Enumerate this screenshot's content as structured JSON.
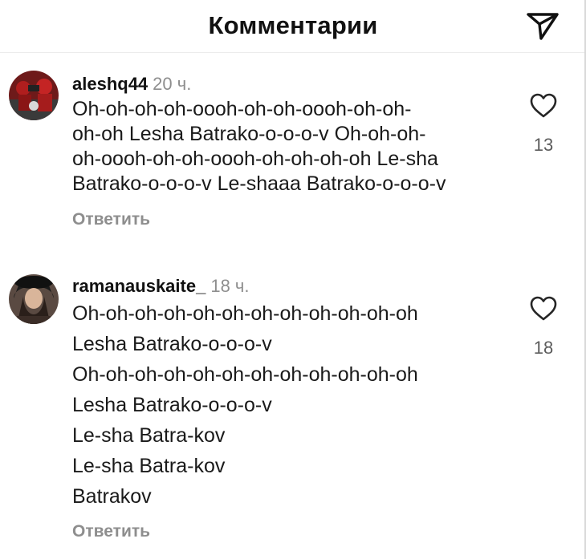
{
  "header": {
    "title": "Комментарии"
  },
  "comments": [
    {
      "username": "aleshq44",
      "time": "20 ч.",
      "text": "Oh-oh-oh-oh-oooh-oh-oh-oooh-oh-oh-oh-oh Lesha Batrako-o-o-o-v Oh-oh-oh-oh-oooh-oh-oh-oooh-oh-oh-oh-oh Le-sha Batrako-o-o-o-v Le-shaaa Batrako-o-o-o-v",
      "lines": [
        "Oh-oh-oh-oh-oooh-oh-oh-oooh-oh-oh-",
        "oh-oh Lesha Batrako-o-o-o-v Oh-oh-oh-",
        "oh-oooh-oh-oh-oooh-oh-oh-oh-oh Le-sha",
        "Batrako-o-o-o-v Le-shaaa Batrako-o-o-o-v"
      ],
      "reply_label": "Ответить",
      "likes": "13",
      "avatar_icon": "avatar-photo"
    },
    {
      "username": "ramanauskaite_",
      "time": "18 ч.",
      "lines": [
        "Oh-oh-oh-oh-oh-oh-oh-oh-oh-oh-oh-oh",
        "Lesha Batrako-o-o-o-v",
        "Oh-oh-oh-oh-oh-oh-oh-oh-oh-oh-oh-oh",
        "Lesha Batrako-o-o-o-v",
        "Le-sha Batra-kov",
        "Le-sha Batra-kov",
        "Batrakov"
      ],
      "reply_label": "Ответить",
      "likes": "18",
      "avatar_icon": "avatar-photo"
    }
  ],
  "icons": {
    "share": "paper-plane-icon",
    "like": "heart-icon"
  },
  "colors": {
    "text": "#111111",
    "secondary": "#8e8e8e",
    "divider": "#ececec"
  }
}
